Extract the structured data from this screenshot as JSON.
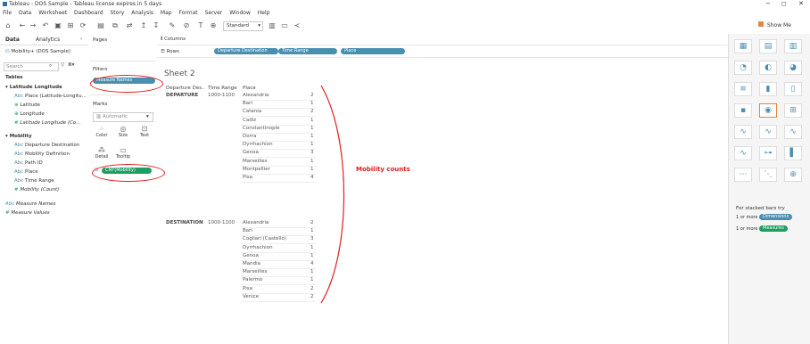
{
  "window": {
    "title": "Tableau - DOS Sample - Tableau license expires in 5 days",
    "min": "−",
    "max": "◻",
    "close": "✕"
  },
  "menu": [
    "File",
    "Data",
    "Worksheet",
    "Dashboard",
    "Story",
    "Analysis",
    "Map",
    "Format",
    "Server",
    "Window",
    "Help"
  ],
  "toolbar": {
    "fit_select": "Standard",
    "show_me": "Show Me"
  },
  "data_pane": {
    "tab_data": "Data",
    "tab_analytics": "Analytics",
    "datasource": "Mobility+ (DOS Sample)",
    "search_placeholder": "Search",
    "tables_label": "Tables",
    "group1": {
      "name": "Latitude Longitude",
      "items": [
        "Place (Latitude-Longitu...",
        "Latitude",
        "Longitude",
        "Latitude Longitude (Co..."
      ]
    },
    "group2": {
      "name": "Mobility",
      "items": [
        "Departure Destination",
        "Mobility Definition",
        "Path ID",
        "Place",
        "Time Range",
        "Mobility (Count)"
      ]
    },
    "measure_names": "Measure Names",
    "measure_values": "Measure Values"
  },
  "pages_pane": {
    "pages": "Pages",
    "filters": "Filters",
    "filter_pill": "Measure Names",
    "marks": "Marks",
    "marks_type": "Automatic",
    "mark_buttons": [
      "Color",
      "Size",
      "Text",
      "Detail",
      "Tooltip"
    ],
    "cnt_pill": "CNT(Mobility)"
  },
  "shelves": {
    "columns": "Columns",
    "rows": "Rows",
    "row_pills": [
      "Departure Destination",
      "Time Range",
      "Place"
    ]
  },
  "sheet": {
    "title": "Sheet 2",
    "headers": [
      "Departure Des..",
      "Time Range",
      "Place"
    ],
    "groups": [
      {
        "dep": "DEPARTURE",
        "time": "1000-1100",
        "rows": [
          [
            "Alexandria",
            "2"
          ],
          [
            "Bari",
            "1"
          ],
          [
            "Catania",
            "2"
          ],
          [
            "Cadiz",
            "1"
          ],
          [
            "Constantinople",
            "1"
          ],
          [
            "Dorra",
            "1"
          ],
          [
            "Dyrrhachion",
            "1"
          ],
          [
            "Genoa",
            "3"
          ],
          [
            "Marseilles",
            "1"
          ],
          [
            "Montpellier",
            "1"
          ],
          [
            "Pisa",
            "4"
          ]
        ]
      },
      {
        "dep": "DESTINATION",
        "time": "1000-1100",
        "rows": [
          [
            "Alexandria",
            "2"
          ],
          [
            "Bari",
            "1"
          ],
          [
            "Cogliari (Castello)",
            "3"
          ],
          [
            "Dyrrhachion",
            "1"
          ],
          [
            "Genoa",
            "1"
          ],
          [
            "Mandia",
            "4"
          ],
          [
            "Marseilles",
            "1"
          ],
          [
            "Palermo",
            "1"
          ],
          [
            "Pisa",
            "2"
          ],
          [
            "Venice",
            "2"
          ]
        ]
      }
    ]
  },
  "annotation": "Mobility counts",
  "show_me": {
    "hint": "For stacked bars try",
    "line1_prefix": "1 or more",
    "line1_pill": "Dimensions",
    "line2_prefix": "1 or more",
    "line2_pill": "Measures"
  }
}
